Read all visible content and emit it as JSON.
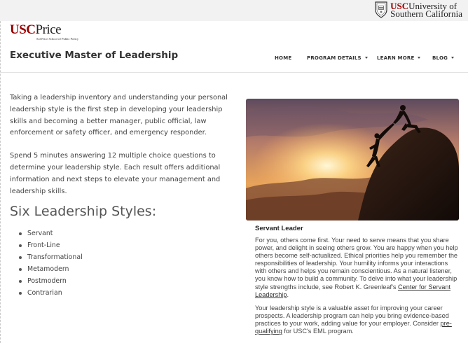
{
  "university_bar": {
    "brand_usc": "USC",
    "line1_rest": "University of",
    "line2": "Southern California"
  },
  "logo": {
    "usc": "USC",
    "price": "Price",
    "subtitle": "Sol Price School of Public Policy"
  },
  "header": {
    "title": "Executive Master of Leadership",
    "nav": [
      {
        "label": "HOME",
        "has_dropdown": false
      },
      {
        "label": "PROGRAM DETAILS",
        "has_dropdown": true
      },
      {
        "label": "LEARN MORE",
        "has_dropdown": true
      },
      {
        "label": "BLOG",
        "has_dropdown": true
      }
    ]
  },
  "intro": {
    "p1": "Taking a leadership inventory and understanding your personal leadership style is the first step in developing your leadership skills and becoming a better manager, public official, law enforcement or safety officer, and emergency responder.",
    "p2": "Spend 5 minutes answering 12 multiple choice questions to determine your leadership style. Each result offers additional information and next steps to elevate your management and leadership skills."
  },
  "styles": {
    "heading": "Six Leadership Styles:",
    "items": [
      "Servant",
      "Front-Line",
      "Transformational",
      "Metamodern",
      "Postmodern",
      "Contrarian"
    ]
  },
  "card": {
    "image_subject": "two climbers helping each other up a cliff at sunset",
    "title": "Servant Leader",
    "p1_text": "For you, others come first. Your need to serve means that you share power, and delight in seeing others grow. You are happy when you help others become self-actualized. Ethical priorities help you remember the responsibilities of leadership. Your humility informs your interactions with others and helps you remain conscientious. As a natural listener, you know how to build a community. To delve into what your leadership style strengths include, see Robert K. Greenleaf's ",
    "p1_link": "Center for Servant Leadership",
    "p1_end": ".",
    "p2_text": "Your leadership style is a valuable asset for improving your career prospects. A leadership program can help you bring evidence-based practices to your work, adding value for your employer. Consider ",
    "p2_link": "pre-qualifying",
    "p2_end": " for USC's EML program."
  },
  "colors": {
    "usc_cardinal": "#990000",
    "text": "#444444"
  }
}
